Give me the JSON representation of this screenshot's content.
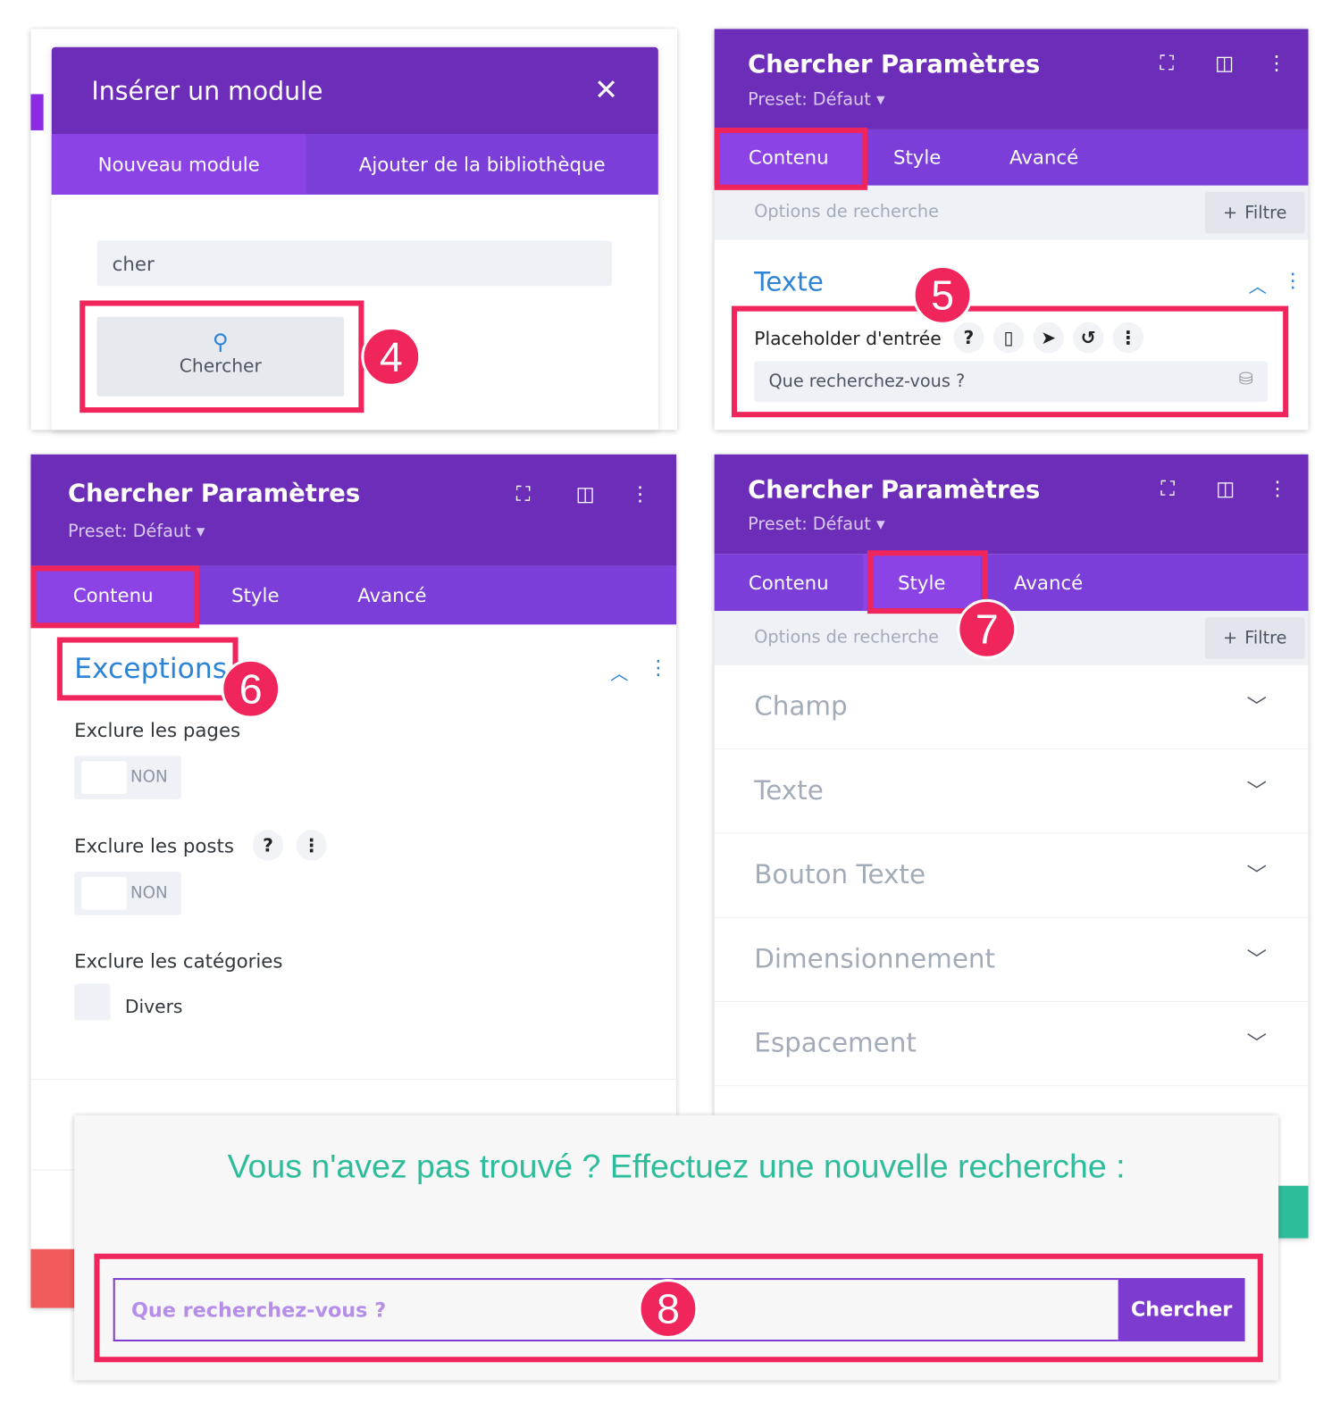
{
  "colors": {
    "purple_header": "#6c2eb9",
    "purple_tabs": "#7b3ed8",
    "highlight": "#f0255c",
    "teal": "#2ebd9b",
    "link_blue": "#2d84d6"
  },
  "step_badges": [
    "4",
    "5",
    "6",
    "7",
    "8"
  ],
  "insert_module": {
    "title": "Insérer un module",
    "close_icon": "close-icon",
    "tabs": [
      {
        "label": "Nouveau module",
        "active": true
      },
      {
        "label": "Ajouter de la bibliothèque",
        "active": false
      }
    ],
    "search_value": "cher",
    "result": {
      "icon": "search-icon",
      "label": "Chercher"
    }
  },
  "settings_common": {
    "title": "Chercher Paramètres",
    "preset": "Preset: Défaut",
    "tabs": [
      "Contenu",
      "Style",
      "Avancé"
    ],
    "options_placeholder": "Options de recherche",
    "filter_label": "Filtre"
  },
  "panel_texte": {
    "active_tab": "Contenu",
    "section": "Texte",
    "field_label": "Placeholder d'entrée",
    "field_value": "Que recherchez-vous ?"
  },
  "panel_exceptions": {
    "active_tab": "Contenu",
    "section": "Exceptions",
    "fields": [
      {
        "label": "Exclure les pages",
        "value": "NON"
      },
      {
        "label": "Exclure les posts",
        "value": "NON"
      }
    ],
    "categories_label": "Exclure les catégories",
    "category_option": "Divers"
  },
  "panel_style": {
    "active_tab": "Style",
    "sections": [
      "Champ",
      "Texte",
      "Bouton Texte",
      "Dimensionnement",
      "Espacement"
    ]
  },
  "preview": {
    "heading": "Vous n'avez pas trouvé ? Effectuez une nouvelle recherche :",
    "placeholder": "Que recherchez-vous ?",
    "button": "Chercher"
  }
}
